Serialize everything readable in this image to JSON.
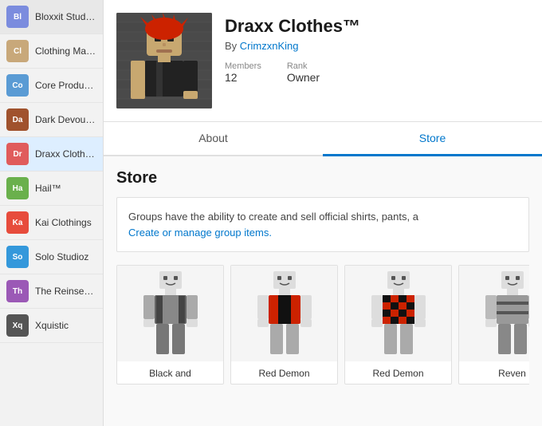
{
  "sidebar": {
    "items": [
      {
        "id": "bloxxit",
        "label": "Bloxxit Studios",
        "color": "#7b8cde"
      },
      {
        "id": "clothing-mania",
        "label": "Clothing Mania",
        "color": "#c8a87a"
      },
      {
        "id": "core-product",
        "label": "Core Product...",
        "color": "#5a9bd4"
      },
      {
        "id": "dark-devoure",
        "label": "Dark Devoure...",
        "color": "#a0522d"
      },
      {
        "id": "draxx-clothes",
        "label": "Draxx Clothe...",
        "color": "#e05c5c"
      },
      {
        "id": "hail",
        "label": "Hail™",
        "color": "#6ab04c"
      },
      {
        "id": "kai-clothings",
        "label": "Kai Clothings",
        "color": "#e74c3c"
      },
      {
        "id": "solo-studioz",
        "label": "Solo Studioz",
        "color": "#3498db"
      },
      {
        "id": "the-reinsegen",
        "label": "The Reinsegen",
        "color": "#9b59b6"
      },
      {
        "id": "xquistic",
        "label": "Xquistic",
        "color": "#555"
      }
    ]
  },
  "group": {
    "name": "Draxx Clothes™",
    "creator_prefix": "By",
    "creator": "CrimzxnKing",
    "members_label": "Members",
    "members_value": "12",
    "rank_label": "Rank",
    "rank_value": "Owner"
  },
  "tabs": [
    {
      "id": "about",
      "label": "About",
      "active": false
    },
    {
      "id": "store",
      "label": "Store",
      "active": true
    }
  ],
  "store": {
    "title": "Store",
    "notice": "Groups have the ability to create and sell official shirts, pants, a",
    "notice_link": "Create or manage group items.",
    "items": [
      {
        "id": "black-and",
        "name": "Black and",
        "body_color": "#555"
      },
      {
        "id": "red-demon-1",
        "name": "Red Demon",
        "body_color": "#cc2200"
      },
      {
        "id": "red-demon-2",
        "name": "Red Demon",
        "body_color": "#cc2200"
      },
      {
        "id": "reven",
        "name": "Reven",
        "body_color": "#888"
      }
    ]
  }
}
